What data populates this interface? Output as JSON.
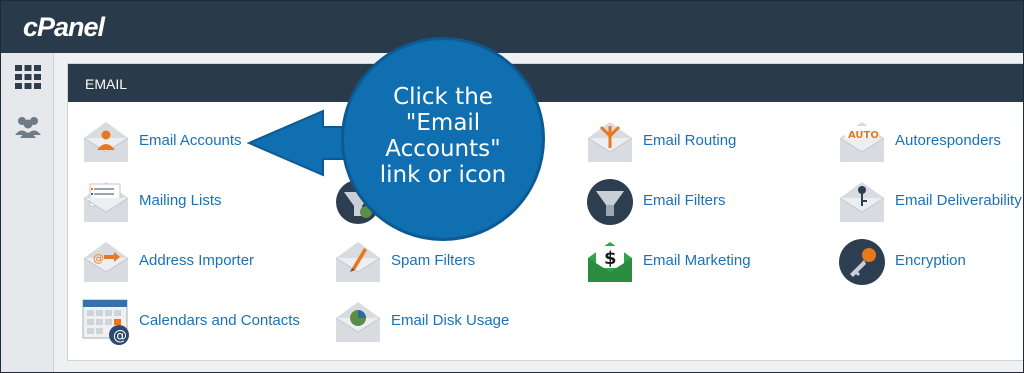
{
  "app": {
    "logo": "cPanel"
  },
  "section": {
    "title": "EMAIL"
  },
  "items": [
    {
      "label": "Email Accounts",
      "icon": "email-accounts-icon"
    },
    {
      "label": "Mailing Lists",
      "icon": "mailing-lists-icon"
    },
    {
      "label": "Address Importer",
      "icon": "address-importer-icon"
    },
    {
      "label": "Calendars and Contacts",
      "icon": "calendar-icon"
    },
    {
      "label": "Spam Filters",
      "icon": "spam-filters-icon"
    },
    {
      "label": "Email Disk Usage",
      "icon": "disk-usage-icon"
    },
    {
      "label": "Email Routing",
      "icon": "email-routing-icon"
    },
    {
      "label": "Email Filters",
      "icon": "email-filters-icon"
    },
    {
      "label": "Email Marketing",
      "icon": "email-marketing-icon"
    },
    {
      "label": "Autoresponders",
      "icon": "autoresponders-icon"
    },
    {
      "label": "Email Deliverability",
      "icon": "deliverability-icon"
    },
    {
      "label": "Encryption",
      "icon": "encryption-icon"
    }
  ],
  "icon_text": {
    "autoresponder_badge": "AUTO",
    "marketing_symbol": "$",
    "calendar_at": "@"
  },
  "callout": {
    "text": "Click the\n\"Email\nAccounts\"\nlink or icon"
  },
  "colors": {
    "topbar": "#293a4a",
    "link": "#1b71b8",
    "callout": "#0f6fb0"
  }
}
